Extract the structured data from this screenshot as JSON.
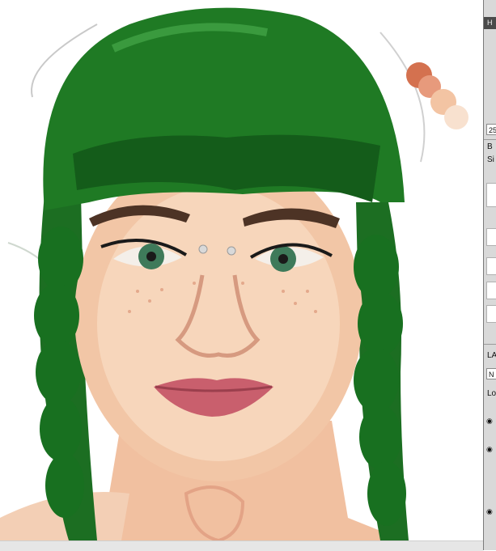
{
  "panel": {
    "title": "H",
    "zoom_value": "25",
    "brush_label": "B",
    "size_label": "Si",
    "layers_label": "LA",
    "blend_mode": "N",
    "lock_label": "Lo"
  },
  "icons": {
    "visibility": "eye-icon",
    "brush_preset": "brush-preset-icon"
  },
  "colors": {
    "hair": "#1f7a24",
    "skin": "#f2c6a6",
    "lips": "#c95f6d",
    "swatch1": "#d4714f",
    "swatch2": "#e79a7c",
    "swatch3": "#f3c4a3",
    "swatch4": "#f8e1cf"
  }
}
